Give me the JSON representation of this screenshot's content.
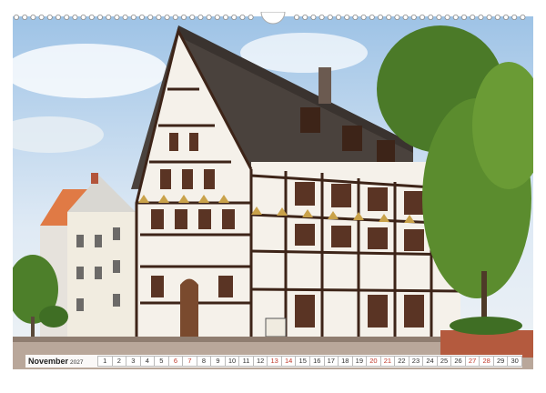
{
  "calendar": {
    "month": "November",
    "year": "2027",
    "days": [
      "1",
      "2",
      "3",
      "4",
      "5",
      "6",
      "7",
      "8",
      "9",
      "10",
      "11",
      "12",
      "13",
      "14",
      "15",
      "16",
      "17",
      "18",
      "19",
      "20",
      "21",
      "22",
      "23",
      "24",
      "25",
      "26",
      "27",
      "28",
      "29",
      "30"
    ],
    "weekend_days": [
      "6",
      "7",
      "13",
      "14",
      "20",
      "21",
      "27",
      "28"
    ]
  },
  "photo": {
    "sign_text": "",
    "colors": {
      "sky": "#d7e6f4",
      "beams": "#3d2418",
      "plaster": "#f5f1ea",
      "roof": "#4a423d",
      "tree": "#5b8c2e"
    }
  }
}
